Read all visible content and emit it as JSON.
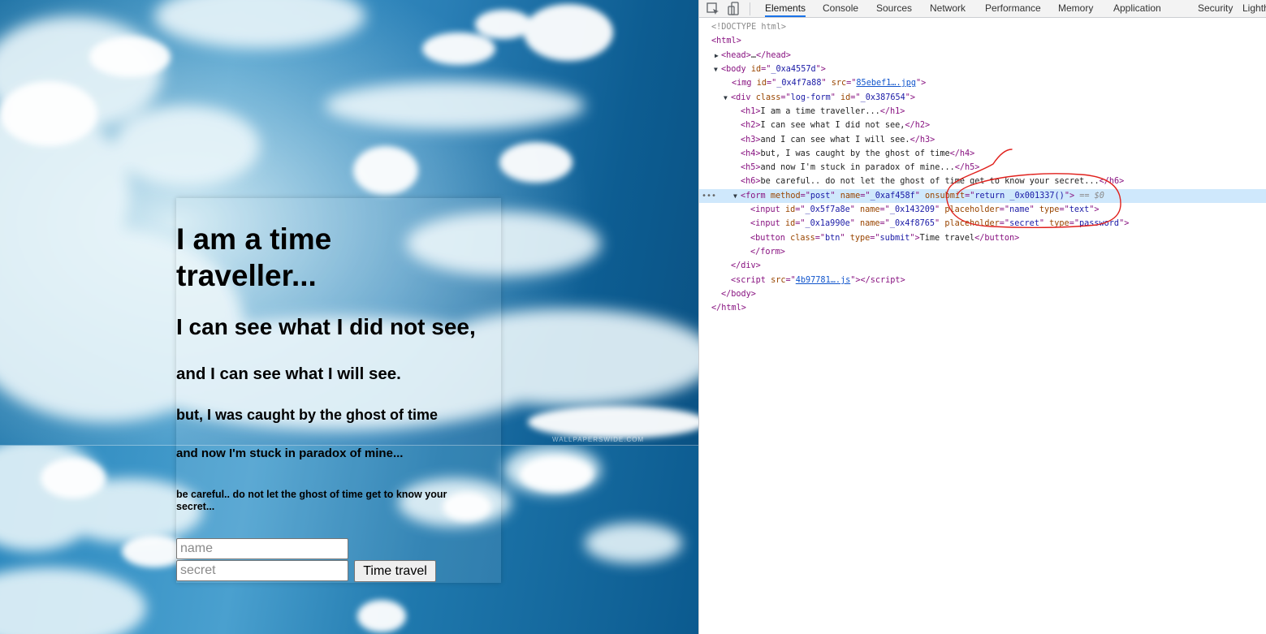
{
  "page": {
    "watermark": "WALLPAPERSWIDE.COM",
    "headings": {
      "h1": "I am a time traveller...",
      "h2": "I can see what I did not see,",
      "h3": "and I can see what I will see.",
      "h4": "but, I was caught by the ghost of time",
      "h5": "and now I'm stuck in paradox of mine...",
      "h6": "be careful.. do not let the ghost of time get to know your secret..."
    },
    "form": {
      "name_placeholder": "name",
      "secret_placeholder": "secret",
      "button_label": "Time travel"
    }
  },
  "devtools": {
    "tabs": [
      "Elements",
      "Console",
      "Sources",
      "Network",
      "Performance",
      "Memory",
      "Application",
      "Security",
      "Lighth"
    ],
    "active_tab": "Elements",
    "tree": {
      "doctype": "<!DOCTYPE html>",
      "html_open": "html",
      "head_tag": "head",
      "head_ellipsis": "…",
      "body_tag": "body",
      "body_id": "_0xa4557d",
      "img_tag": "img",
      "img_id": "_0x4f7a88",
      "img_src": "85ebef1….jpg",
      "div_tag": "div",
      "div_class": "log-form",
      "div_id": "_0x387654",
      "h1_text": "I am a time traveller...",
      "h2_text": "I can see what I did not see,",
      "h3_text": "and I can see what I will see.",
      "h4_text": "but, I was caught by the ghost of time",
      "h5_text": "and now I'm stuck in paradox of mine...",
      "h6_text": "be careful.. do not let the ghost of time get to know your secret...",
      "form_method": "post",
      "form_name": "_0xaf458f",
      "form_onsubmit": "return _0x001337()",
      "selected_marker": "== $0",
      "input1_id": "_0x5f7a8e",
      "input1_name": "_0x143209",
      "input1_placeholder": "name",
      "input1_type": "text",
      "input2_id": "_0x1a990e",
      "input2_name": "_0x4f8765",
      "input2_placeholder": "secret",
      "input2_type": "password",
      "button_class": "btn",
      "button_type": "submit",
      "button_text": "Time travel",
      "script_src": "4b97781….js"
    }
  },
  "colors": {
    "annotation": "#e0201c",
    "tag": "#881280",
    "attr_name": "#994500",
    "attr_value": "#1a1aa6",
    "selected_row": "#cfe8fc",
    "active_tab_underline": "#1a73e8"
  }
}
